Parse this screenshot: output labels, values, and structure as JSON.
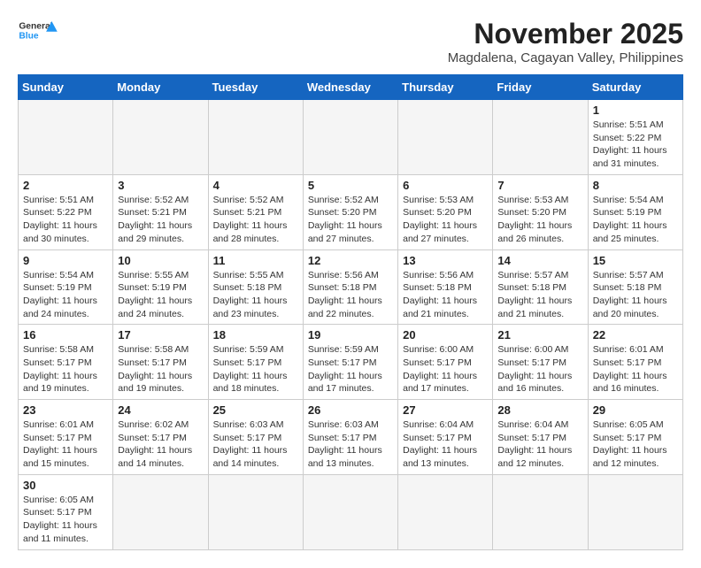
{
  "header": {
    "logo_text_general": "General",
    "logo_text_blue": "Blue",
    "title": "November 2025",
    "subtitle": "Magdalena, Cagayan Valley, Philippines"
  },
  "weekdays": [
    "Sunday",
    "Monday",
    "Tuesday",
    "Wednesday",
    "Thursday",
    "Friday",
    "Saturday"
  ],
  "days": [
    {
      "num": "",
      "info": ""
    },
    {
      "num": "",
      "info": ""
    },
    {
      "num": "",
      "info": ""
    },
    {
      "num": "",
      "info": ""
    },
    {
      "num": "",
      "info": ""
    },
    {
      "num": "",
      "info": ""
    },
    {
      "num": "1",
      "info": "Sunrise: 5:51 AM\nSunset: 5:22 PM\nDaylight: 11 hours\nand 31 minutes."
    },
    {
      "num": "2",
      "info": "Sunrise: 5:51 AM\nSunset: 5:22 PM\nDaylight: 11 hours\nand 30 minutes."
    },
    {
      "num": "3",
      "info": "Sunrise: 5:52 AM\nSunset: 5:21 PM\nDaylight: 11 hours\nand 29 minutes."
    },
    {
      "num": "4",
      "info": "Sunrise: 5:52 AM\nSunset: 5:21 PM\nDaylight: 11 hours\nand 28 minutes."
    },
    {
      "num": "5",
      "info": "Sunrise: 5:52 AM\nSunset: 5:20 PM\nDaylight: 11 hours\nand 27 minutes."
    },
    {
      "num": "6",
      "info": "Sunrise: 5:53 AM\nSunset: 5:20 PM\nDaylight: 11 hours\nand 27 minutes."
    },
    {
      "num": "7",
      "info": "Sunrise: 5:53 AM\nSunset: 5:20 PM\nDaylight: 11 hours\nand 26 minutes."
    },
    {
      "num": "8",
      "info": "Sunrise: 5:54 AM\nSunset: 5:19 PM\nDaylight: 11 hours\nand 25 minutes."
    },
    {
      "num": "9",
      "info": "Sunrise: 5:54 AM\nSunset: 5:19 PM\nDaylight: 11 hours\nand 24 minutes."
    },
    {
      "num": "10",
      "info": "Sunrise: 5:55 AM\nSunset: 5:19 PM\nDaylight: 11 hours\nand 24 minutes."
    },
    {
      "num": "11",
      "info": "Sunrise: 5:55 AM\nSunset: 5:18 PM\nDaylight: 11 hours\nand 23 minutes."
    },
    {
      "num": "12",
      "info": "Sunrise: 5:56 AM\nSunset: 5:18 PM\nDaylight: 11 hours\nand 22 minutes."
    },
    {
      "num": "13",
      "info": "Sunrise: 5:56 AM\nSunset: 5:18 PM\nDaylight: 11 hours\nand 21 minutes."
    },
    {
      "num": "14",
      "info": "Sunrise: 5:57 AM\nSunset: 5:18 PM\nDaylight: 11 hours\nand 21 minutes."
    },
    {
      "num": "15",
      "info": "Sunrise: 5:57 AM\nSunset: 5:18 PM\nDaylight: 11 hours\nand 20 minutes."
    },
    {
      "num": "16",
      "info": "Sunrise: 5:58 AM\nSunset: 5:17 PM\nDaylight: 11 hours\nand 19 minutes."
    },
    {
      "num": "17",
      "info": "Sunrise: 5:58 AM\nSunset: 5:17 PM\nDaylight: 11 hours\nand 19 minutes."
    },
    {
      "num": "18",
      "info": "Sunrise: 5:59 AM\nSunset: 5:17 PM\nDaylight: 11 hours\nand 18 minutes."
    },
    {
      "num": "19",
      "info": "Sunrise: 5:59 AM\nSunset: 5:17 PM\nDaylight: 11 hours\nand 17 minutes."
    },
    {
      "num": "20",
      "info": "Sunrise: 6:00 AM\nSunset: 5:17 PM\nDaylight: 11 hours\nand 17 minutes."
    },
    {
      "num": "21",
      "info": "Sunrise: 6:00 AM\nSunset: 5:17 PM\nDaylight: 11 hours\nand 16 minutes."
    },
    {
      "num": "22",
      "info": "Sunrise: 6:01 AM\nSunset: 5:17 PM\nDaylight: 11 hours\nand 16 minutes."
    },
    {
      "num": "23",
      "info": "Sunrise: 6:01 AM\nSunset: 5:17 PM\nDaylight: 11 hours\nand 15 minutes."
    },
    {
      "num": "24",
      "info": "Sunrise: 6:02 AM\nSunset: 5:17 PM\nDaylight: 11 hours\nand 14 minutes."
    },
    {
      "num": "25",
      "info": "Sunrise: 6:03 AM\nSunset: 5:17 PM\nDaylight: 11 hours\nand 14 minutes."
    },
    {
      "num": "26",
      "info": "Sunrise: 6:03 AM\nSunset: 5:17 PM\nDaylight: 11 hours\nand 13 minutes."
    },
    {
      "num": "27",
      "info": "Sunrise: 6:04 AM\nSunset: 5:17 PM\nDaylight: 11 hours\nand 13 minutes."
    },
    {
      "num": "28",
      "info": "Sunrise: 6:04 AM\nSunset: 5:17 PM\nDaylight: 11 hours\nand 12 minutes."
    },
    {
      "num": "29",
      "info": "Sunrise: 6:05 AM\nSunset: 5:17 PM\nDaylight: 11 hours\nand 12 minutes."
    },
    {
      "num": "30",
      "info": "Sunrise: 6:05 AM\nSunset: 5:17 PM\nDaylight: 11 hours\nand 11 minutes."
    }
  ]
}
